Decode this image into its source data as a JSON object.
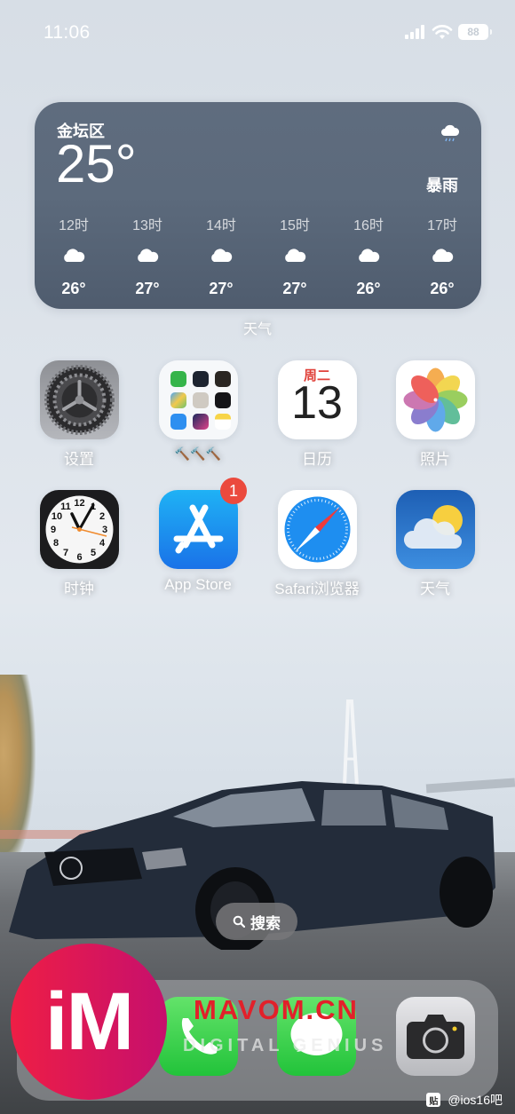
{
  "status_bar": {
    "time": "11:06",
    "battery_percent": "88",
    "signal_icon": "cellular-signal-icon",
    "wifi_icon": "wifi-icon"
  },
  "weather_widget": {
    "location": "金坛区",
    "current_temp": "25°",
    "condition": "暴雨",
    "condition_icon": "cloud-rain-icon",
    "hourly": [
      {
        "hour": "12时",
        "icon": "cloud-icon",
        "temp": "26°"
      },
      {
        "hour": "13时",
        "icon": "cloud-icon",
        "temp": "27°"
      },
      {
        "hour": "14时",
        "icon": "cloud-icon",
        "temp": "27°"
      },
      {
        "hour": "15时",
        "icon": "cloud-icon",
        "temp": "27°"
      },
      {
        "hour": "16时",
        "icon": "cloud-icon",
        "temp": "26°"
      },
      {
        "hour": "17时",
        "icon": "cloud-icon",
        "temp": "26°"
      }
    ],
    "label": "天气"
  },
  "apps": [
    {
      "name": "settings",
      "label": "设置"
    },
    {
      "name": "tools-folder",
      "label": "🔨🔨🔨"
    },
    {
      "name": "calendar",
      "label": "日历",
      "weekday": "周二",
      "day": "13"
    },
    {
      "name": "photos",
      "label": "照片"
    },
    {
      "name": "clock",
      "label": "时钟"
    },
    {
      "name": "app-store",
      "label": "App Store",
      "badge": "1"
    },
    {
      "name": "safari",
      "label": "Safari浏览器"
    },
    {
      "name": "weather",
      "label": "天气"
    }
  ],
  "search": {
    "label": "搜索"
  },
  "dock": [
    "phone",
    "messages",
    "camera"
  ],
  "watermark": {
    "logo_text": "iM",
    "site": "MAVOM.CN",
    "tagline": "DIGITAL GENIUS",
    "credit": "@ios16吧",
    "credit_box": "贴"
  },
  "colors": {
    "badge": "#eb4a3d",
    "calendar_red": "#e0413a",
    "widget_bg": "#5c6a7c",
    "watermark_red": "#e2202a"
  }
}
